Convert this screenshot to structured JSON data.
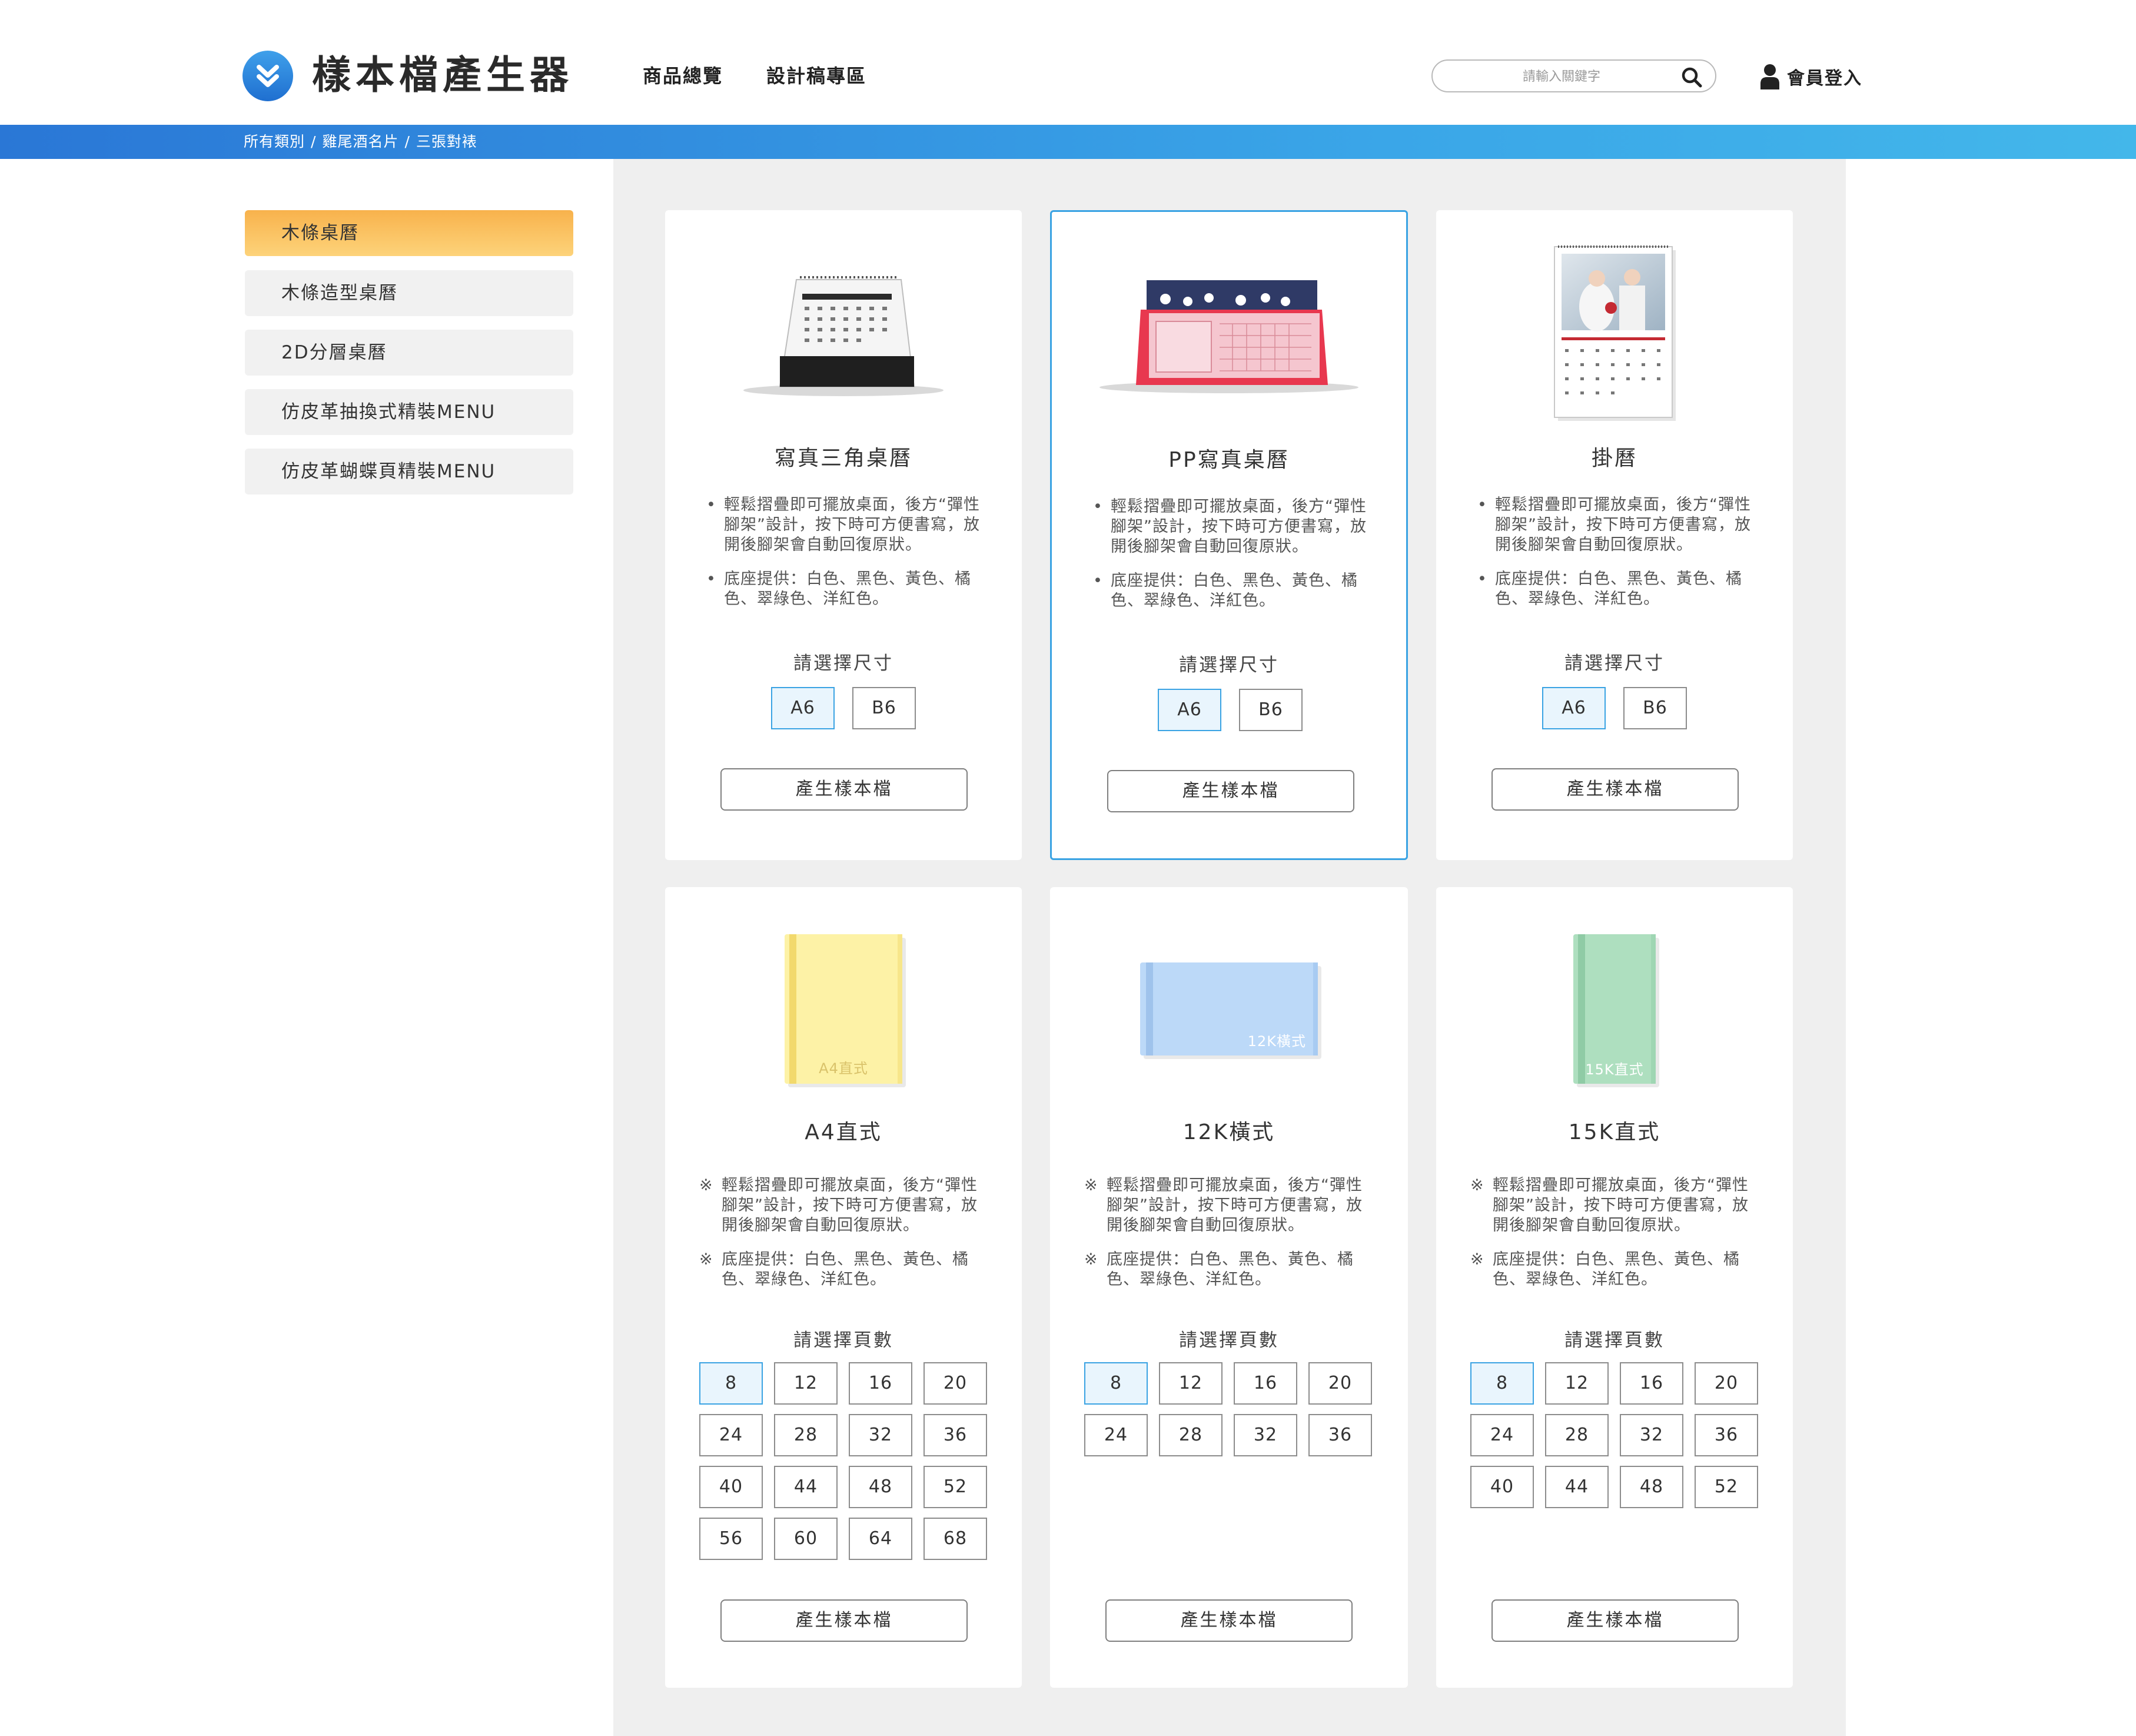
{
  "header": {
    "brand": "樣本檔產生器",
    "nav": [
      "商品總覽",
      "設計稿專區"
    ],
    "search_placeholder": "請輸入關鍵字",
    "login_label": "會員登入"
  },
  "breadcrumb": [
    "所有類別",
    "雞尾酒名片",
    "三張對裱"
  ],
  "sidebar": {
    "items": [
      {
        "label": "木條桌曆",
        "active": true
      },
      {
        "label": "木條造型桌曆",
        "active": false
      },
      {
        "label": "2D分層桌曆",
        "active": false
      },
      {
        "label": "仿皮革抽換式精裝MENU",
        "active": false
      },
      {
        "label": "仿皮革蝴蝶頁精裝MENU",
        "active": false
      }
    ]
  },
  "cards": [
    {
      "title": "寫真三角桌曆",
      "image": "triangle-desk-calendar",
      "bullet": "•",
      "desc": [
        "輕鬆摺疊即可擺放桌面，後方“彈性腳架”設計，按下時可方便書寫，放開後腳架會自動回復原狀。",
        "底座提供：白色、黑色、黃色、橘色、翠綠色、洋紅色。"
      ],
      "select_label": "請選擇尺寸",
      "options": [
        "A6",
        "B6"
      ],
      "selected_option": "A6",
      "button": "產生樣本檔"
    },
    {
      "title": "PP寫真桌曆",
      "image": "pp-desk-calendar",
      "bullet": "•",
      "desc": [
        "輕鬆摺疊即可擺放桌面，後方“彈性腳架”設計，按下時可方便書寫，放開後腳架會自動回復原狀。",
        "底座提供：白色、黑色、黃色、橘色、翠綠色、洋紅色。"
      ],
      "select_label": "請選擇尺寸",
      "options": [
        "A6",
        "B6"
      ],
      "selected_option": "A6",
      "button": "產生樣本檔"
    },
    {
      "title": "掛曆",
      "image": "wall-calendar",
      "bullet": "•",
      "desc": [
        "輕鬆摺疊即可擺放桌面，後方“彈性腳架”設計，按下時可方便書寫，放開後腳架會自動回復原狀。",
        "底座提供：白色、黑色、黃色、橘色、翠綠色、洋紅色。"
      ],
      "select_label": "請選擇尺寸",
      "options": [
        "A6",
        "B6"
      ],
      "selected_option": "A6",
      "button": "產生樣本檔"
    },
    {
      "title": "A4直式",
      "image": "notebook-a4-portrait",
      "cover_text": "A4直式",
      "bullet": "※",
      "desc": [
        "輕鬆摺疊即可擺放桌面，後方“彈性腳架”設計，按下時可方便書寫，放開後腳架會自動回復原狀。",
        "底座提供：白色、黑色、黃色、橘色、翠綠色、洋紅色。"
      ],
      "select_label": "請選擇頁數",
      "options": [
        "8",
        "12",
        "16",
        "20",
        "24",
        "28",
        "32",
        "36",
        "40",
        "44",
        "48",
        "52",
        "56",
        "60",
        "64",
        "68"
      ],
      "selected_option": "8",
      "button": "產生樣本檔"
    },
    {
      "title": "12K橫式",
      "image": "notebook-12k-landscape",
      "cover_text": "12K橫式",
      "bullet": "※",
      "desc": [
        "輕鬆摺疊即可擺放桌面，後方“彈性腳架”設計，按下時可方便書寫，放開後腳架會自動回復原狀。",
        "底座提供：白色、黑色、黃色、橘色、翠綠色、洋紅色。"
      ],
      "select_label": "請選擇頁數",
      "options": [
        "8",
        "12",
        "16",
        "20",
        "24",
        "28",
        "32",
        "36"
      ],
      "selected_option": "8",
      "button": "產生樣本檔"
    },
    {
      "title": "15K直式",
      "image": "notebook-15k-portrait",
      "cover_text": "15K直式",
      "bullet": "※",
      "desc": [
        "輕鬆摺疊即可擺放桌面，後方“彈性腳架”設計，按下時可方便書寫，放開後腳架會自動回復原狀。",
        "底座提供：白色、黑色、黃色、橘色、翠綠色、洋紅色。"
      ],
      "select_label": "請選擇頁數",
      "options": [
        "8",
        "12",
        "16",
        "20",
        "24",
        "28",
        "32",
        "36",
        "40",
        "44",
        "48",
        "52"
      ],
      "selected_option": "8",
      "button": "產生樣本檔"
    }
  ],
  "colors": {
    "accent_blue": "#3aa3e3",
    "sidebar_active": "#f8b24c",
    "panel_gray": "#efefef"
  },
  "icons": {
    "logo": "double-chevron-down-icon",
    "search": "search-icon",
    "user": "user-icon"
  }
}
